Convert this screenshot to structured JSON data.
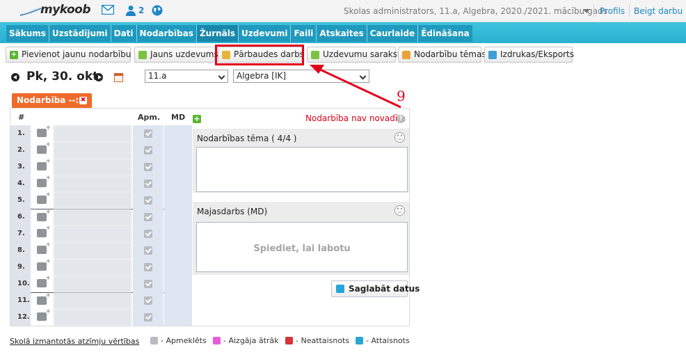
{
  "header": {
    "logo_text": "mykoob",
    "user_count": "2",
    "context": "Skolas administrators, 11.a, Algebra, 2020./2021. mācību gads",
    "links": {
      "profile": "Profils",
      "logout": "Beigt darbu"
    }
  },
  "nav": {
    "items": [
      {
        "label": "Sākums"
      },
      {
        "label": "Uzstādījumi"
      },
      {
        "label": "Dati"
      },
      {
        "label": "Nodarbības"
      },
      {
        "label": "Žurnāls"
      },
      {
        "label": "Uzdevumi"
      },
      {
        "label": "Faili"
      },
      {
        "label": "Atskaites"
      },
      {
        "label": "Caurlaide"
      },
      {
        "label": "Ēdināšana"
      }
    ]
  },
  "toolbar": {
    "add_lesson": "Pievienot jaunu nodarbību",
    "new_task": "Jauns uzdevums",
    "test": "Pārbaudes darbs",
    "task_list": "Uzdevumu saraksts",
    "lesson_topics": "Nodarbību tēmas",
    "print_export": "Izdrukas/Eksports"
  },
  "date_bar": {
    "date": "Pk, 30. okt.",
    "class_select": "11.a",
    "subject_select": "Algebra [IK]"
  },
  "lesson_tab": {
    "label": "Nodarbība --:--"
  },
  "students": {
    "headers": {
      "num": "#",
      "apm": "Apm.",
      "md": "MD"
    },
    "rows": [
      {
        "num": "1."
      },
      {
        "num": "2."
      },
      {
        "num": "3."
      },
      {
        "num": "4."
      },
      {
        "num": "5."
      },
      {
        "num": "6."
      },
      {
        "num": "7."
      },
      {
        "num": "8."
      },
      {
        "num": "9."
      },
      {
        "num": "10."
      },
      {
        "num": "11."
      },
      {
        "num": "12."
      }
    ]
  },
  "right_panel": {
    "status": "Nodarbība nav novadīta",
    "topic_title": "Nodarbības tēma ( 4/4 )",
    "homework_title": "Majasdarbs (MD)",
    "homework_placeholder": "Spiediet, lai labotu",
    "save": "Saglabāt datus"
  },
  "legend": {
    "link": "Skolā izmantotās atzīmju vērtības",
    "items": [
      {
        "label": "- Apmeklēts",
        "color": "#b8bcc0"
      },
      {
        "label": "- Aizgāja ātrāk",
        "color": "#e85be0"
      },
      {
        "label": "- Neattaisnots",
        "color": "#d8323a"
      },
      {
        "label": "- Attaisnots",
        "color": "#2aa6d6"
      }
    ]
  },
  "annotation": {
    "number": "9"
  },
  "colors": {
    "accent": "#2bb0cf",
    "nav_dark": "#1f99bd",
    "tab_orange": "#ef6a2a",
    "highlight": "#e3001b"
  },
  "icons": {
    "mail": "mail-icon",
    "user": "user-icon",
    "globe": "globe-icon",
    "calendar": "calendar-icon"
  }
}
